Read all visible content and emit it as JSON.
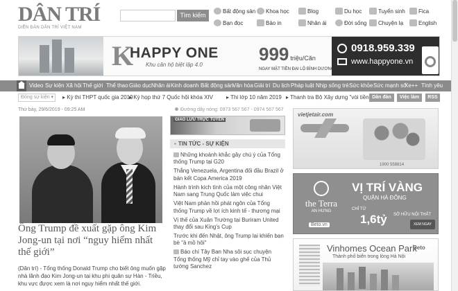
{
  "header": {
    "logo_text": "DÂN TRÍ",
    "tagline": "DIỄN ĐÀN DÂN TRÍ VIỆT NAM",
    "search_placeholder": "",
    "search_button": "Tìm kiếm",
    "quick_links": [
      "Bất động sản",
      "Khoa học",
      "Blog",
      "Du học",
      "Tuyển sinh",
      "Fica",
      "Bạn đọc",
      "Bảo in",
      "Nhân ái",
      "Đời sống",
      "Chuyện lạ",
      "English"
    ]
  },
  "banner": {
    "brand": "HAPPY ONE",
    "brand_slogan": "Khu căn hộ biệt lập 4.0",
    "price": "999",
    "price_unit": "triệu/Căn",
    "price_caption": "NGAY MẶT TIỀN ĐẠI LỘ BÌNH DƯƠNG",
    "phone": "0918.959.339",
    "website": "www.happyone.vn"
  },
  "nav": {
    "items": [
      "Video",
      "Sự kiện",
      "Xã hội",
      "Thế giới",
      "Thể thao",
      "Giáo dục",
      "Nhân ái",
      "Kinh doanh",
      "Bất động sản",
      "Văn hóa",
      "Giải trí",
      "Du lịch",
      "Pháp luật",
      "Nhịp sống trẻ",
      "Sức khỏe",
      "Sức mạnh số",
      "Xe++",
      "Tình yêu"
    ]
  },
  "trending": {
    "select": "Đóng sự kiện",
    "links": [
      "Kỳ thi THPT quốc gia 2019",
      "Kỳ họp thứ 7 Quốc hội khóa XIV",
      "Thi lớp 10 năm 2019",
      "Thanh tra Bộ Xây dựng \"vòi tiền\""
    ],
    "buttons": [
      "Dân đàn",
      "Việc làm",
      "RSS"
    ]
  },
  "main": {
    "date": "Thứ bảy, 29/6/2019 - 09:25 AM",
    "headline": "Ông Trump đề xuất gặp ông Kim Jong-un tại nơi “nguy hiểm nhất thế giới”",
    "lead": "(Dân trí) - Tổng thống Donald Trump cho biết ông muốn gặp nhà lãnh đạo Kim Jong-un tại khu phi quân sự Hàn - Triều, khu vực được xem là nơi nguy hiểm nhất thế giới."
  },
  "middle": {
    "hotline": "Đường dây nóng: 0973 567 567 - 0974 567 567",
    "ad_label": "GIAO LƯU TRỰC TUYẾN",
    "section_title": "TIN TỨC - SỰ KIỆN",
    "news": [
      "Những khoảnh khắc gây chú ý của Tổng thống Trump tại G20",
      "Thắng Venezuela, Argentina đối đầu Brazil ở bán kết Copa America 2019",
      "Hành trình kích tình của một công nhân Việt Nam sang Trung Quốc làm việc chui",
      "Việt Nam phản hồi phát ngôn của Tổng thống Trump về lợi ích kinh tế - thương mại",
      "Vị thế của Xuân Trường tại Buriram United thay đổi sau King's Cup",
      "Trước khi đến Nhật, ông Trump lại khiến bạn bè \"ả mồ hôi\"",
      "Báo chí Tây Ban Nha sôi sục chuyện Tổng thống Mỹ chỉ tay vào ghế của Thủ tướng Sanchez"
    ]
  },
  "right_ads": {
    "ad1_brand": "vietjetair.com",
    "ad1_hotline": "1900 558814",
    "ad2_title": "VỊ TRÍ VÀNG",
    "ad2_sub": "QUẬN HÀ ĐÔNG",
    "ad2_brand": "the Terra",
    "ad2_brand_sub": "AN HƯNG",
    "ad2_from": "CHỈ TỪ",
    "ad2_price": "1,6tỷ",
    "ad2_m2": "SỞ HỮU NỘI THẤT",
    "ad2_button": "XEM NGAY",
    "ad2_beto": "Beto.vn",
    "ad3_title": "Vinhomes Ocean Park",
    "ad3_sub": "Thành phố biển trong lòng Hà Nội",
    "ad3_logo": "Beto"
  }
}
